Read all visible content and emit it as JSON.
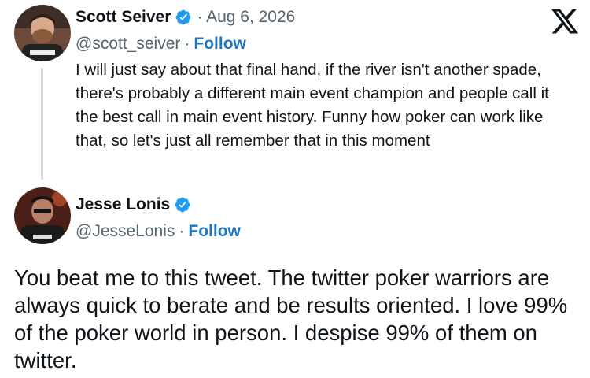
{
  "brand": {
    "icon": "x-logo-icon",
    "color": "#0f1419",
    "link_color": "#1d76c2",
    "verified_color": "#1d9bf0"
  },
  "tweet1": {
    "author_name": "Scott Seiver",
    "verified": true,
    "separator": "·",
    "date": "Aug 6, 2026",
    "handle": "@scott_seiver",
    "follow_label": "Follow",
    "text": "I will just say about that final hand, if the river isn't another spade, there's probably a different main event champion and people call it the best call in main event history. Funny how poker can work like that, so let's just all remember that in this moment"
  },
  "tweet2": {
    "author_name": "Jesse Lonis",
    "verified": true,
    "separator": "·",
    "handle": "@JesseLonis",
    "follow_label": "Follow",
    "text": "You beat me to this tweet. The twitter poker warriors are always quick to berate and be results oriented. I love 99% of the poker world in person. I despise 99% of them on twitter."
  }
}
